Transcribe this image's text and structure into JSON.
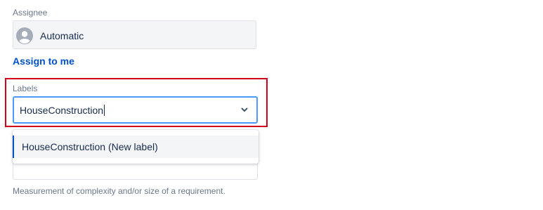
{
  "assignee": {
    "label": "Assignee",
    "value": "Automatic",
    "avatar_icon": "user-avatar-icon",
    "assign_to_me": "Assign to me"
  },
  "labels": {
    "label": "Labels",
    "input_value": "HouseConstruction",
    "chevron_icon": "chevron-down-icon",
    "highlight_color": "#d0021b",
    "focus_color": "#4c9aff"
  },
  "dropdown": {
    "options": [
      {
        "label": "HouseConstruction (New label)"
      }
    ]
  },
  "story_points": {
    "help_text": "Measurement of complexity and/or size of a requirement."
  },
  "colors": {
    "link": "#0052cc",
    "field_bg": "#f4f5f7",
    "muted_text": "#6b778c"
  }
}
